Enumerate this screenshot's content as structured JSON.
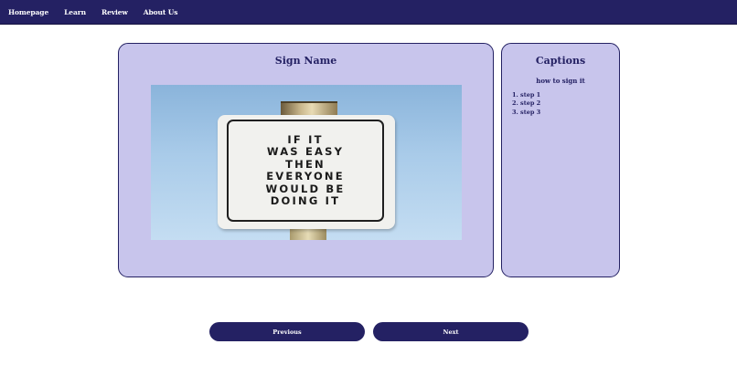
{
  "nav": {
    "items": [
      {
        "label": "Homepage"
      },
      {
        "label": "Learn"
      },
      {
        "label": "Review"
      },
      {
        "label": "About Us"
      }
    ]
  },
  "main": {
    "title": "Sign Name",
    "image": {
      "sign_text": "IF IT\nWAS EASY\nTHEN\nEVERYONE\nWOULD BE\nDOING IT"
    }
  },
  "captions": {
    "title": "Captions",
    "subtitle": "how to sign it",
    "steps": [
      {
        "label": "1. step 1"
      },
      {
        "label": "2. step 2"
      },
      {
        "label": "3. step 3"
      }
    ]
  },
  "buttons": {
    "previous_label": "Previous",
    "next_label": "Next"
  },
  "colors": {
    "navbar": "#242163",
    "card_bg": "#c8c5ec",
    "accent": "#242163"
  }
}
